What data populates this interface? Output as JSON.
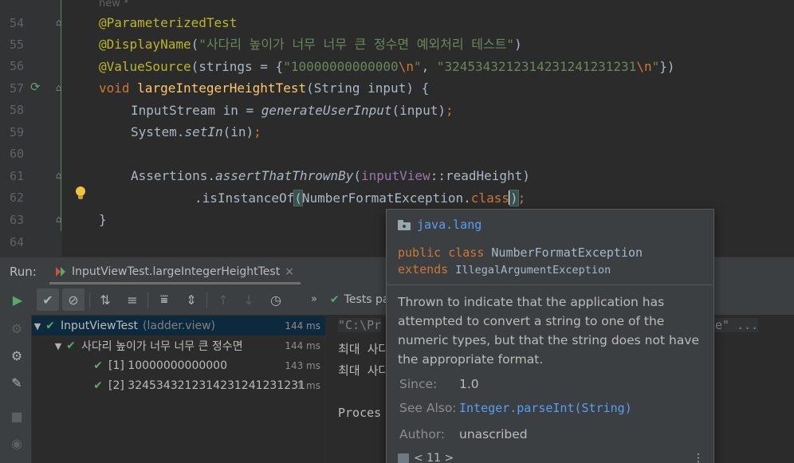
{
  "editor": {
    "line_numbers": [
      "54",
      "55",
      "56",
      "57",
      "58",
      "59",
      "60",
      "61",
      "62",
      "63",
      "64"
    ],
    "top_hint": "new *",
    "lines": {
      "l54": "@ParameterizedTest",
      "l55_ann": "@DisplayName",
      "l55_open": "(",
      "l55_str": "\"사다리 높이가 너무 너무 큰 정수면 예외처리 테스트\"",
      "l55_close": ")",
      "l56_ann": "@ValueSource",
      "l56_a": "(strings = {",
      "l56_s1": "\"10000000000000",
      "l56_e1": "\\n",
      "l56_q1": "\"",
      "l56_comma": ", ",
      "l56_s2": "\"3245343212314231241231231",
      "l56_e2": "\\n",
      "l56_q2": "\"",
      "l56_b": "})",
      "l57_kw": "void ",
      "l57_fn": "largeIntegerHeightTest",
      "l57_rest": "(String input) {",
      "l58_a": "InputStream in = ",
      "l58_fn": "generateUserInput",
      "l58_b": "(input)",
      "l58_semi": ";",
      "l59_a": "System.",
      "l59_fn": "setIn",
      "l59_b": "(in)",
      "l59_semi": ";",
      "l61_a": "Assertions.",
      "l61_fn": "assertThatThrownBy",
      "l61_b": "(",
      "l61_fld": "inputView",
      "l61_c": "::readHeight)",
      "l62_a": ".isInstanceOf",
      "l62_b": "(",
      "l62_c": "NumberFormatException.",
      "l62_kw": "class",
      "l62_d": ")",
      "l62_semi": ";",
      "l63": "}"
    }
  },
  "run_panel": {
    "label": "Run:",
    "tab_title": "InputViewTest.largeIntegerHeightTest",
    "tab_close": "×",
    "tests_passed": "Tests pa",
    "more": "»"
  },
  "tree": {
    "rows": [
      {
        "name": "InputViewTest",
        "package": "(ladder.view)",
        "duration": "144 ms"
      },
      {
        "name": "사다리 높이가 너무 너무 큰 정수면",
        "duration": "144 ms"
      },
      {
        "name": "[1] 10000000000000",
        "duration": "143 ms"
      },
      {
        "name": "[2] 3245343212314231241231231",
        "duration": "1 ms"
      }
    ]
  },
  "console": {
    "cmd": "\"C:\\Pr",
    "cmd_tail": "xe\" ...",
    "line1": "최대 사다",
    "line2": "최대 사다",
    "line3": "Proces"
  },
  "doc_popup": {
    "package": "java.lang",
    "decl_public": "public class ",
    "decl_class": "NumberFormatException",
    "decl_extends": "extends ",
    "decl_super": "IllegalArgumentException",
    "description": "Thrown to indicate that the application has attempted to convert a string to one of the numeric types, but that the string does not have the appropriate format.",
    "since_label": "Since:",
    "since_value": "1.0",
    "see_also_label": "See Also:",
    "see_also_value": "Integer.parseInt(String)",
    "author_label": "Author:",
    "author_value": "unascribed",
    "footer": "< 11 >",
    "more": "⋮"
  }
}
